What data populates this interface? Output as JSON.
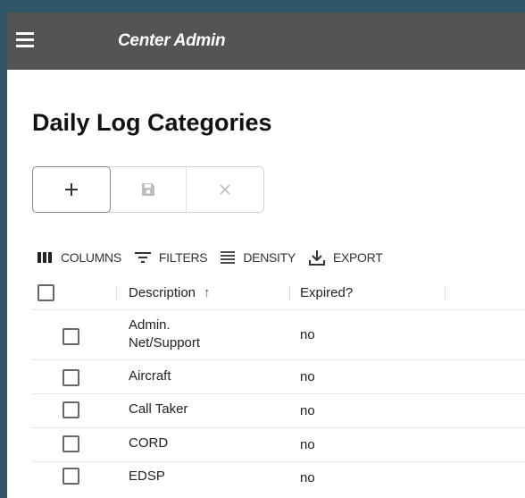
{
  "appbar": {
    "title": "Center Admin"
  },
  "page": {
    "title": "Daily Log Categories"
  },
  "toolbar": {
    "columns_label": "COLUMNS",
    "filters_label": "FILTERS",
    "density_label": "DENSITY",
    "export_label": "EXPORT"
  },
  "grid": {
    "headers": {
      "description": "Description",
      "expired": "Expired?"
    },
    "sort_indicator": "↑",
    "rows": [
      {
        "description": "Admin. Net/Support",
        "expired": "no"
      },
      {
        "description": "Aircraft",
        "expired": "no"
      },
      {
        "description": "Call Taker",
        "expired": "no"
      },
      {
        "description": "CORD",
        "expired": "no"
      },
      {
        "description": "EDSP",
        "expired": "no"
      }
    ]
  },
  "colors": {
    "appbar": "#545454",
    "outer_background": "#2f5566",
    "text": "#222222"
  },
  "icons": {
    "menu": "hamburger-icon",
    "add": "plus-icon",
    "save": "floppy-disk-icon",
    "cancel": "close-icon",
    "columns": "view-column-icon",
    "filters": "filter-list-icon",
    "density": "density-icon",
    "export": "download-icon"
  }
}
